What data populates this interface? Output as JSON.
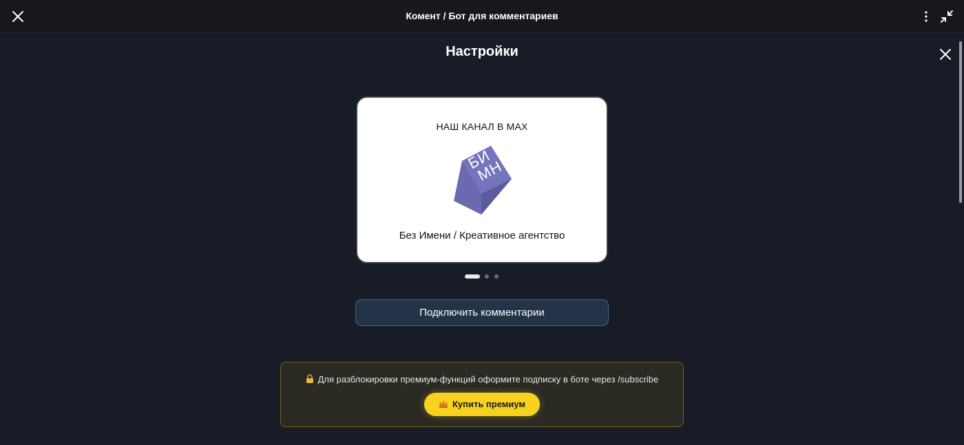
{
  "window": {
    "title": "Комент / Бот для комментариев"
  },
  "settings": {
    "title": "Настройки"
  },
  "carousel": {
    "heading": "НАШ КАНАЛ В MAX",
    "logo_text": "БИ МН",
    "caption": "Без Имени / Креативное агентство",
    "slide_count": 3,
    "active_slide": 1
  },
  "actions": {
    "connect_label": "Подключить комментарии"
  },
  "premium": {
    "notice": "Для разблокировки премиум-функций оформите подписку в боте через /subscribe",
    "buy_label": "Купить премиум"
  },
  "colors": {
    "background": "#181c27",
    "accent_yellow": "#f7d21e",
    "logo_purple": "#6b6ab0",
    "button_blue": "#243448"
  },
  "icons": [
    "close-icon",
    "more-vertical-icon",
    "minimize-icon",
    "lock-icon",
    "crown-icon"
  ]
}
